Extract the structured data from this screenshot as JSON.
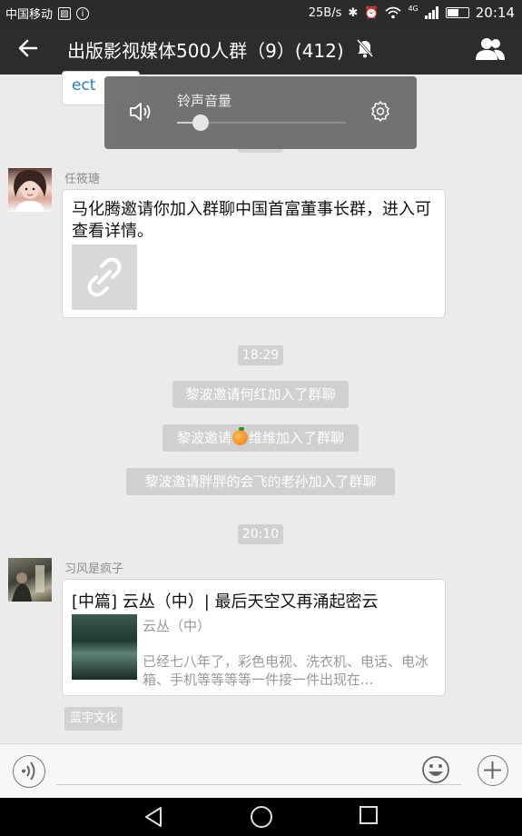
{
  "status_bar": {
    "carrier": "中国移动",
    "net_speed": "25B/s",
    "net_type": "4G",
    "time": "20:14",
    "icons": [
      "photo-icon",
      "info-icon",
      "bluetooth-icon",
      "alarm-icon",
      "wifi-icon",
      "signal-icon",
      "battery-icon"
    ]
  },
  "header": {
    "title": "出版影视媒体500人群（9）(412)",
    "icons": [
      "back-arrow-icon",
      "mute-bell-icon",
      "group-members-icon"
    ]
  },
  "volume_popup": {
    "label": "铃声音量",
    "level": 0.14,
    "icons": [
      "speaker-icon",
      "settings-gear-icon"
    ]
  },
  "chat": {
    "partial_bubble_text": "ect",
    "messages": [
      {
        "sender": "任筱瑭",
        "text": "马化腾邀请你加入群聊中国首富董事长群，进入可查看详情。",
        "thumb_icon": "link-icon"
      }
    ],
    "time_1": "18:29",
    "system_1": "黎波邀请何红加入了群聊",
    "system_2_pre": "黎波邀请",
    "system_2_post": "维维加入了群聊",
    "system_3": "黎波邀请胖胖的会飞的老孙加入了群聊",
    "time_2": "20:10",
    "article": {
      "sender": "习风是疯子",
      "title": "[中篇] 云丛（中）| 最后天空又再涌起密云",
      "source": "云丛（中）",
      "desc": "已经七八年了，彩色电视、洗衣机、电话、电冰箱、手机等等等等一件接一件出现在..."
    },
    "tag": "蓝宇文化"
  },
  "input_bar": {
    "icons": [
      "voice-icon",
      "emoji-icon",
      "plus-icon"
    ]
  },
  "nav_bar": {
    "icons": [
      "nav-back-icon",
      "nav-home-icon",
      "nav-recent-icon"
    ]
  }
}
